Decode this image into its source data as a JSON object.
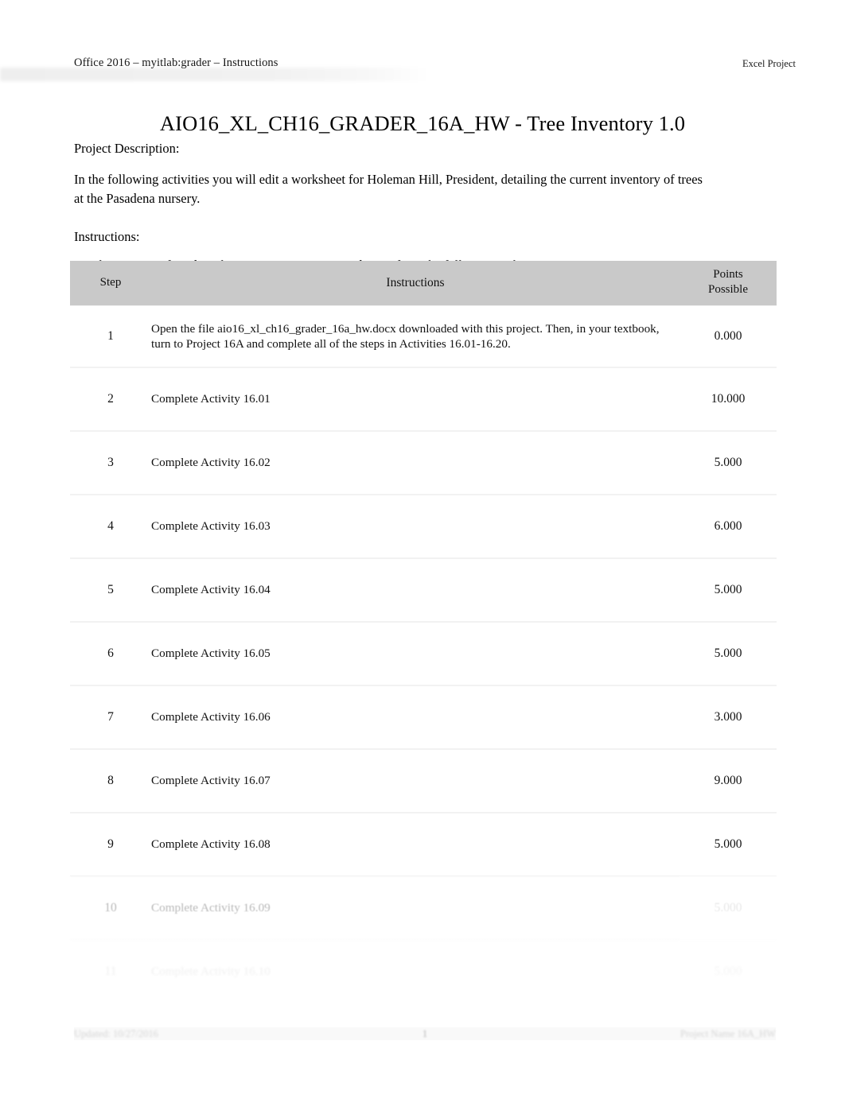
{
  "header": {
    "left": "Office 2016 – myitlab:grader – Instructions",
    "right": "Excel Project"
  },
  "title": "AIO16_XL_CH16_GRADER_16A_HW - Tree Inventory 1.0",
  "sections": {
    "project_description_label": "Project Description:",
    "project_description_text": " In the following activities you will edit a worksheet for Holeman Hill, President, detailing the current inventory of trees at the Pasadena nursery.",
    "instructions_label": "Instructions:",
    "instructions_lead_in": "For the purpose of grading the project you are required to perform the following tasks:"
  },
  "table": {
    "columns": {
      "step": "Step",
      "instructions": "Instructions",
      "points_line1": "Points",
      "points_line2": "Possible"
    },
    "rows": [
      {
        "step": "1",
        "instruction": "Open the file aio16_xl_ch16_grader_16a_hw.docx  downloaded with this project. Then, in your textbook, turn to Project 16A and complete all of the steps in Activities 16.01-16.20.",
        "points": "0.000"
      },
      {
        "step": "2",
        "instruction": "Complete Activity 16.01",
        "points": "10.000"
      },
      {
        "step": "3",
        "instruction": "Complete Activity 16.02",
        "points": "5.000"
      },
      {
        "step": "4",
        "instruction": "Complete Activity 16.03",
        "points": "6.000"
      },
      {
        "step": "5",
        "instruction": "Complete Activity 16.04",
        "points": "5.000"
      },
      {
        "step": "6",
        "instruction": "Complete Activity 16.05",
        "points": "5.000"
      },
      {
        "step": "7",
        "instruction": "Complete Activity 16.06",
        "points": "3.000"
      },
      {
        "step": "8",
        "instruction": "Complete Activity 16.07",
        "points": "9.000"
      },
      {
        "step": "9",
        "instruction": "Complete Activity 16.08",
        "points": "5.000"
      },
      {
        "step": "10",
        "instruction": "Complete Activity 16.09",
        "points": "5.000"
      },
      {
        "step": "11",
        "instruction": "Complete Activity 16.10",
        "points": "5.000"
      }
    ]
  },
  "footer": {
    "left": "Updated: 10/27/2016",
    "center": "1",
    "right": "Project Name 16A_HW"
  },
  "colors": {
    "table_header_bg": "#c9c9c9",
    "page_bg": "#ffffff",
    "text": "#000000"
  }
}
